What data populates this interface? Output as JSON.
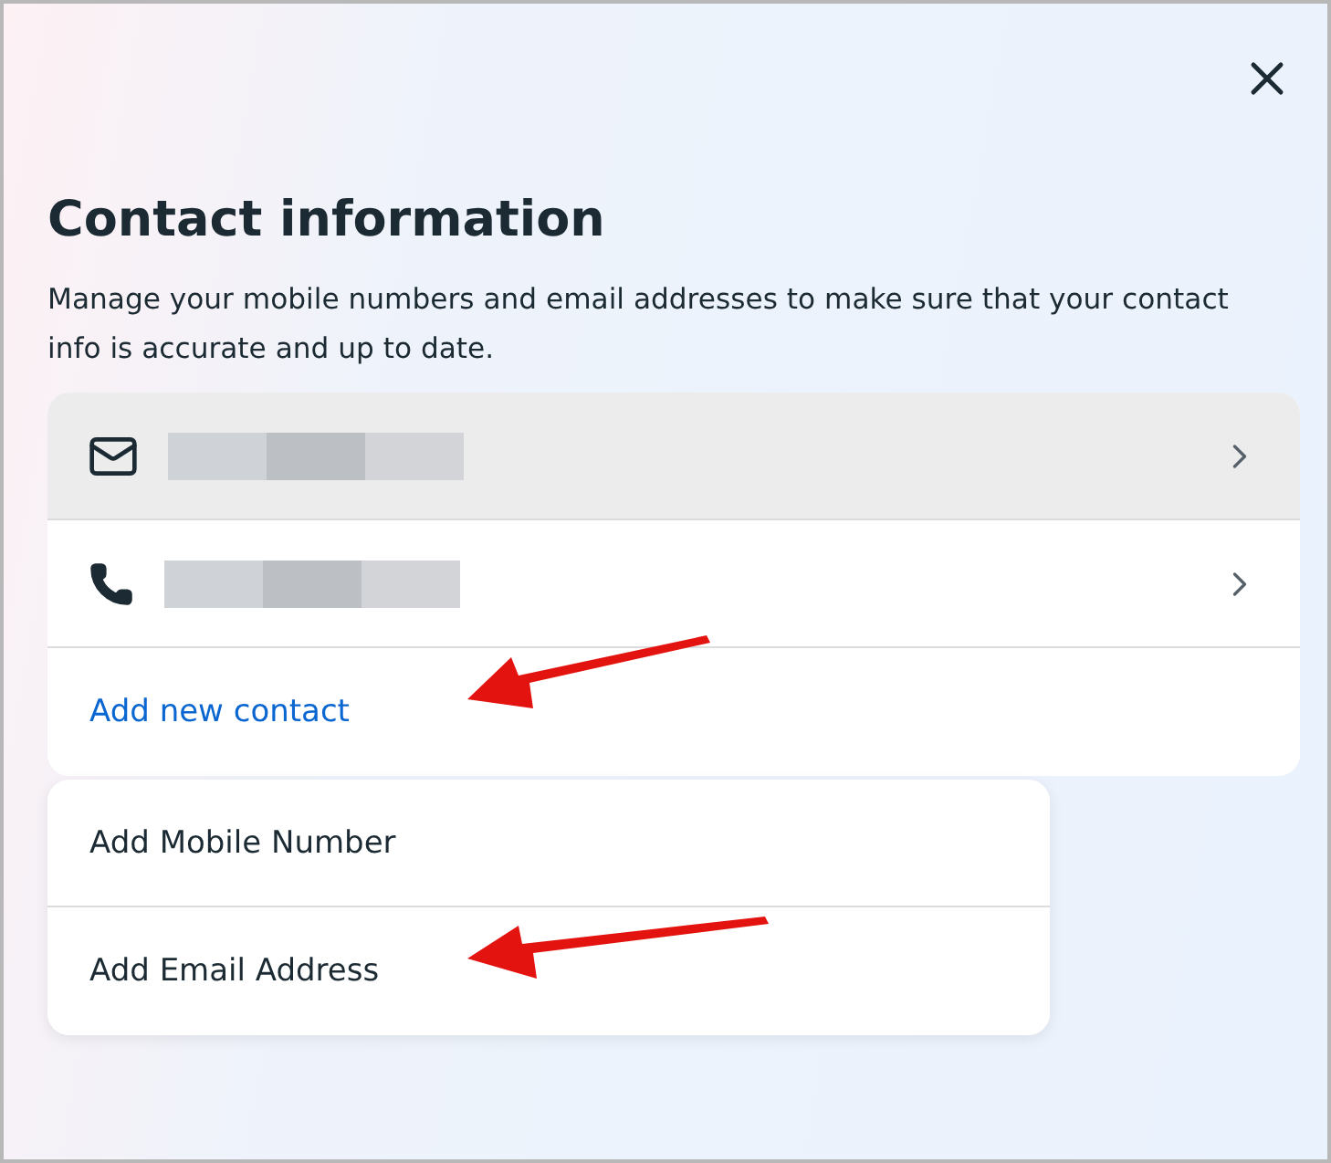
{
  "dialog": {
    "title": "Contact information",
    "description": "Manage your mobile numbers and email addresses to make sure that your contact info is accurate and up to date."
  },
  "contacts": [
    {
      "kind": "email",
      "selected": true
    },
    {
      "kind": "phone",
      "selected": false
    }
  ],
  "add_new_contact": {
    "label": "Add new contact",
    "annotated": true
  },
  "add_menu": [
    {
      "label": "Add Mobile Number",
      "annotated": false
    },
    {
      "label": "Add Email Address",
      "annotated": true
    }
  ]
}
